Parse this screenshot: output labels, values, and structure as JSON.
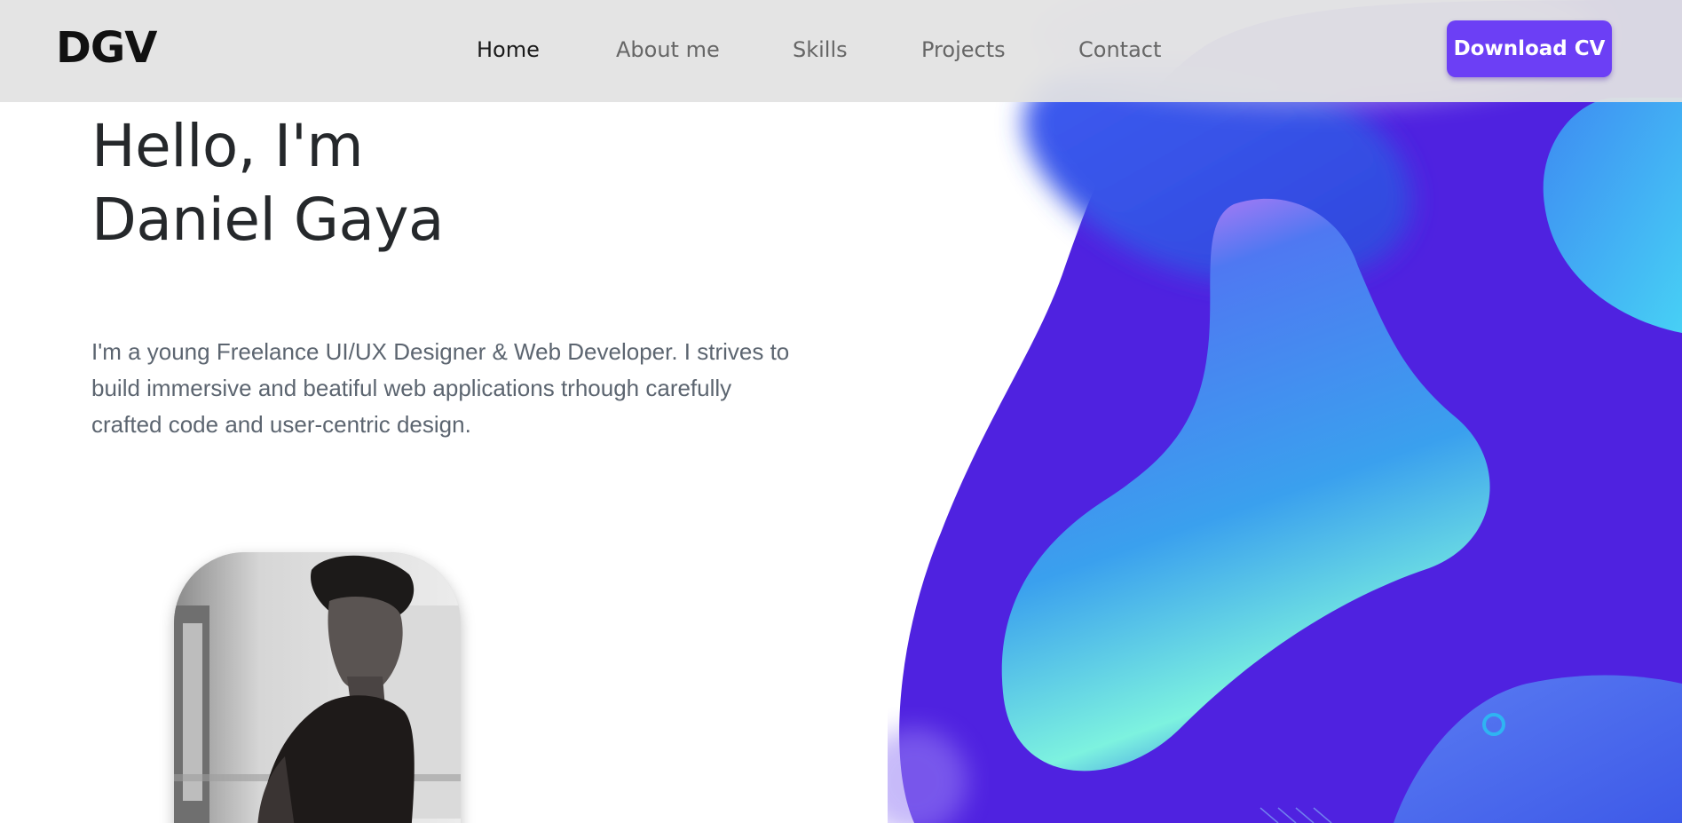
{
  "navbar": {
    "brand": "DGV",
    "links": [
      {
        "label": "Home",
        "active": true
      },
      {
        "label": "About me",
        "active": false
      },
      {
        "label": "Skills",
        "active": false
      },
      {
        "label": "Projects",
        "active": false
      },
      {
        "label": "Contact",
        "active": false
      }
    ],
    "cta_label": "Download CV"
  },
  "hero": {
    "title_line1": "Hello, I'm",
    "title_line2": "Daniel Gaya",
    "description": "I'm a young Freelance UI/UX Designer & Web Developer. I strives to build immersive and beatiful web applications trhough carefully crafted code and user-centric design."
  },
  "colors": {
    "accent": "#6c3ff5",
    "navbar_bg": "#e2e2e2",
    "heading": "#25282b",
    "body_text": "#5c6570",
    "blob_purple": "#4f22e0",
    "blob_blue": "#2a6ef0",
    "blob_cyan": "#7ef0e0"
  }
}
